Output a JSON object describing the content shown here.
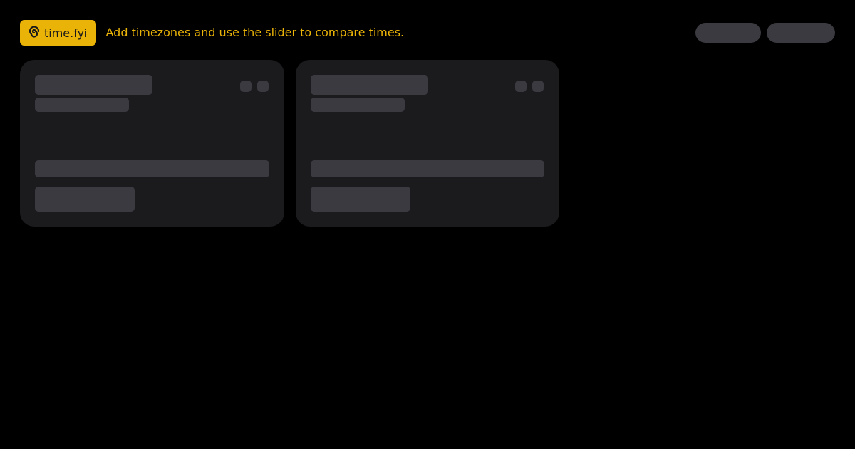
{
  "header": {
    "brand_label": "time.fyi",
    "tagline": "Add timezones and use the slider to compare times."
  },
  "colors": {
    "background": "#000000",
    "accent": "#eab308",
    "card": "#1b1b1e",
    "skeleton": "#3a3a40"
  },
  "icons": {
    "brand": "spiral-logo-icon"
  },
  "state": {
    "loading": true
  }
}
